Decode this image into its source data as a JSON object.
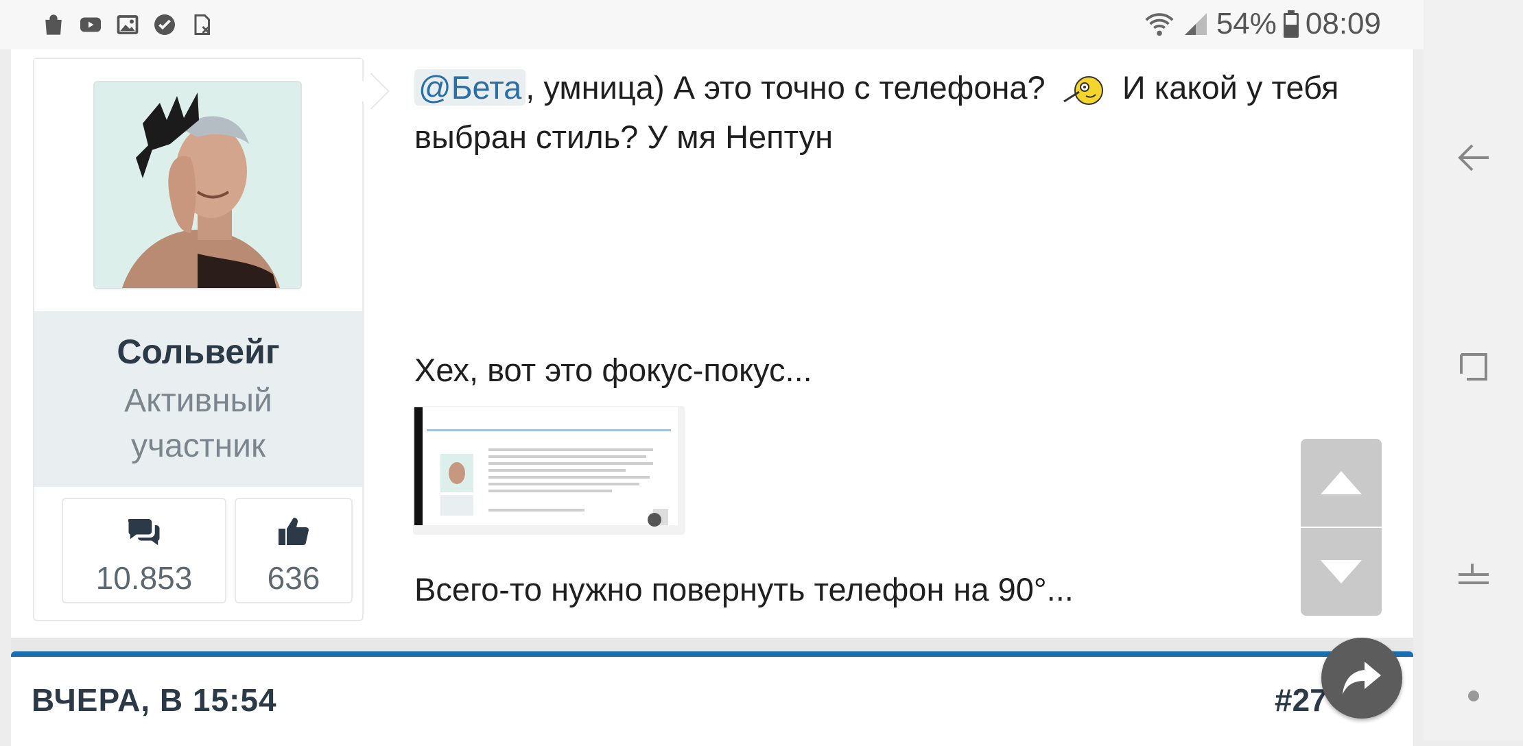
{
  "status_bar": {
    "left_icons": [
      "shopping-bag-icon",
      "youtube-icon",
      "gallery-icon",
      "check-circle-icon",
      "sim-off-icon"
    ],
    "battery_percent": "54%",
    "time": "08:09"
  },
  "post": {
    "author": {
      "name": "Сольвейг",
      "title": "Активный участник",
      "messages_count": "10.853",
      "likes_count": "636"
    },
    "message": {
      "mention": "@Бета",
      "line1_after_mention": ", умница) А это точно с телефона?",
      "line1_tail": "И какой у тебя выбран стиль? У мя Нептун",
      "paragraph2": "Хех, вот это фокус-покус...",
      "paragraph3": "Всего-то нужно повернуть телефон на 90°..."
    }
  },
  "next_post": {
    "date": "ВЧЕРА, В 15:54",
    "number": "#27"
  },
  "colors": {
    "accent": "#1a6fb1",
    "mention_text": "#2a6fa8",
    "username": "#2b3a46"
  }
}
